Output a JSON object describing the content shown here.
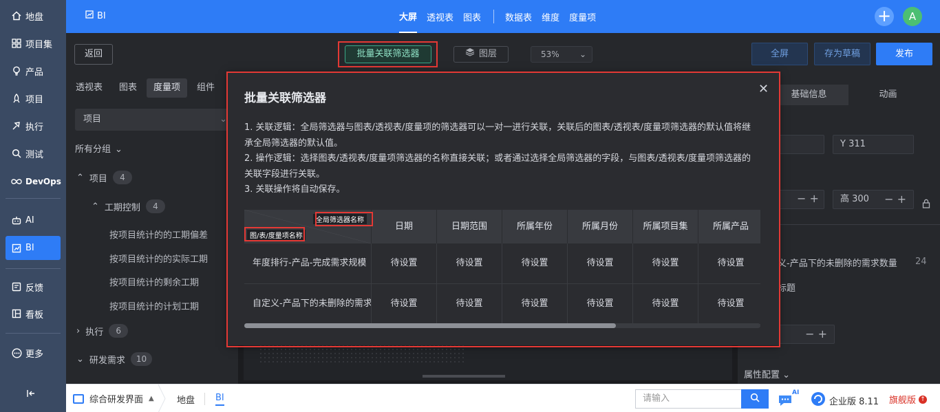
{
  "nav": {
    "items": [
      {
        "icon": "home-icon",
        "label": "地盘"
      },
      {
        "icon": "grid-icon",
        "label": "项目集"
      },
      {
        "icon": "bulb-icon",
        "label": "产品"
      },
      {
        "icon": "rocket-icon",
        "label": "项目"
      },
      {
        "icon": "flash-icon",
        "label": "执行"
      },
      {
        "icon": "search-icon",
        "label": "测试"
      },
      {
        "icon": "infinity-icon",
        "label": "DevOps"
      },
      {
        "icon": "robot-icon",
        "label": "AI"
      },
      {
        "icon": "chart-icon",
        "label": "BI"
      },
      {
        "icon": "feedback-icon",
        "label": "反馈"
      },
      {
        "icon": "board-icon",
        "label": "看板"
      },
      {
        "icon": "more-icon",
        "label": "更多"
      }
    ],
    "active": "BI"
  },
  "topbar": {
    "module": "BI",
    "tabs": [
      "大屏",
      "透视表",
      "图表"
    ],
    "tabs2": [
      "数据表",
      "维度",
      "度量项"
    ],
    "active_tab": "大屏",
    "avatar": "A"
  },
  "toolbar": {
    "back": "返回",
    "batch_filter": "批量关联筛选器",
    "layers": "图层",
    "zoom": "53%",
    "fullscreen": "全屏",
    "save_draft": "存为草稿",
    "publish": "发布"
  },
  "left_panel": {
    "tabs": [
      "透视表",
      "图表",
      "度量项",
      "组件"
    ],
    "active_tab": "度量项",
    "select_value": "项目",
    "all_groups": "所有分组",
    "tree": {
      "project": {
        "label": "项目",
        "count": "4"
      },
      "schedule": {
        "label": "工期控制",
        "count": "4"
      },
      "leaves": [
        "按项目统计的的工期偏差",
        "按项目统计的的实际工期",
        "按项目统计的剩余工期",
        "按项目统计的计划工期"
      ],
      "execution": {
        "label": "执行",
        "count": "6"
      },
      "requirement": {
        "label": "研发需求",
        "count": "10"
      }
    }
  },
  "right_panel": {
    "tabs": [
      "基础信息",
      "动画"
    ],
    "y_value": "Y 311",
    "height_value": "高 300",
    "item_text": "义-产品下的未删除的需求数量",
    "item_count": "24",
    "title_label": "标题",
    "attr_config": "属性配置"
  },
  "modal": {
    "title": "批量关联筛选器",
    "desc": [
      "1. 关联逻辑：全局筛选器与图表/透视表/度量项的筛选器可以一对一进行关联，关联后的图表/透视表/度量项筛选器的默认值将继承全局筛选器的默认值。",
      "2. 操作逻辑：选择图表/透视表/度量项筛选器的名称直接关联；或者通过选择全局筛选器的字段，与图表/透视表/度量项筛选器的关联字段进行关联。",
      "3. 关联操作将自动保存。"
    ],
    "table": {
      "corner_top": "全局筛选器名称",
      "corner_bottom": "图/表/度量项名称",
      "columns": [
        "日期",
        "日期范围",
        "所属年份",
        "所属月份",
        "所属项目集",
        "所属产品"
      ],
      "rows": [
        {
          "name": "年度排行-产品-完成需求规模",
          "cells": [
            "待设置",
            "待设置",
            "待设置",
            "待设置",
            "待设置",
            "待设置"
          ]
        },
        {
          "name": "自定义-产品下的未删除的需求数量",
          "cells": [
            "待设置",
            "待设置",
            "待设置",
            "待设置",
            "待设置",
            "待设置"
          ]
        }
      ]
    }
  },
  "bottombar": {
    "workspace": "综合研发界面",
    "crumbs": [
      "地盘",
      "BI"
    ],
    "active_crumb": "BI",
    "search_placeholder": "请输入",
    "chat_badge": "AI",
    "edition": "企业版 8.11",
    "flagship": "旗舰版"
  },
  "colors": {
    "accent": "#2e7cf6",
    "highlight": "#e53935",
    "filter_green": "#3aa888"
  }
}
